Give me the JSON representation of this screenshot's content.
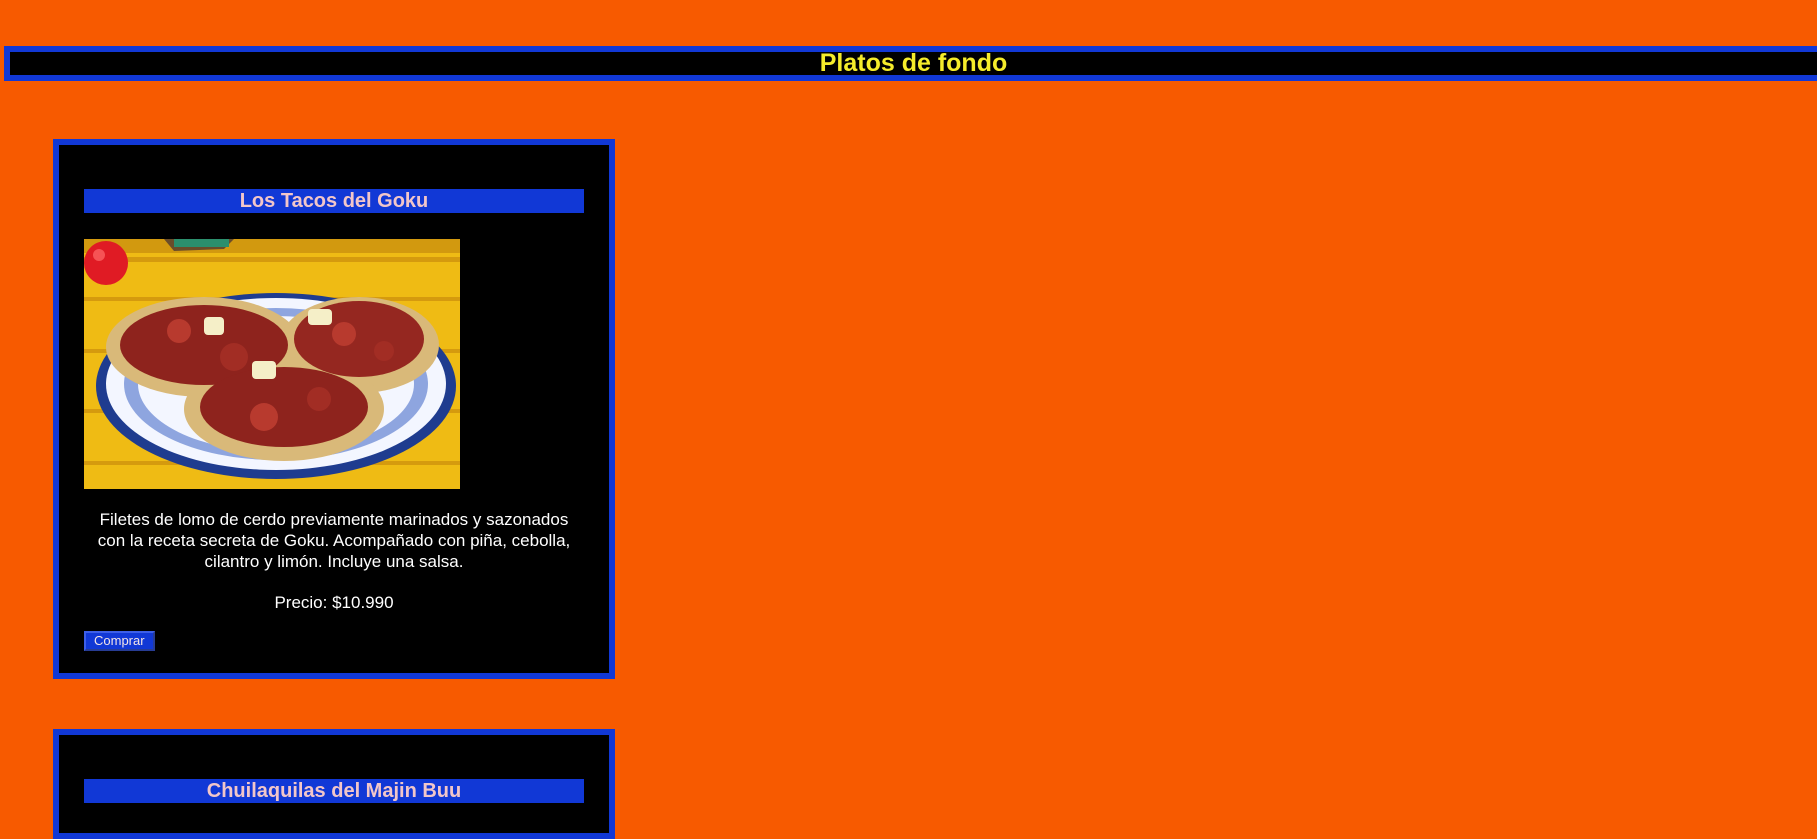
{
  "header": {
    "title": "Platos de fondo"
  },
  "products": [
    {
      "name": "Los Tacos del Goku",
      "image_alt": "tacos-al-pastor-photo",
      "description": "Filetes de lomo de cerdo previamente marinados y sazonados con la receta secreta de Goku. Acompañado con piña, cebolla, cilantro y limón. Incluye una salsa.",
      "price": "Precio: $10.990",
      "buy_label": "Comprar"
    },
    {
      "name": "Chuilaquilas del Majin Buu"
    }
  ],
  "colors": {
    "background": "#f75a00",
    "accent_blue": "#1138d6",
    "header_text": "#f5ec2b",
    "card_title_text": "#f2c6c9"
  }
}
